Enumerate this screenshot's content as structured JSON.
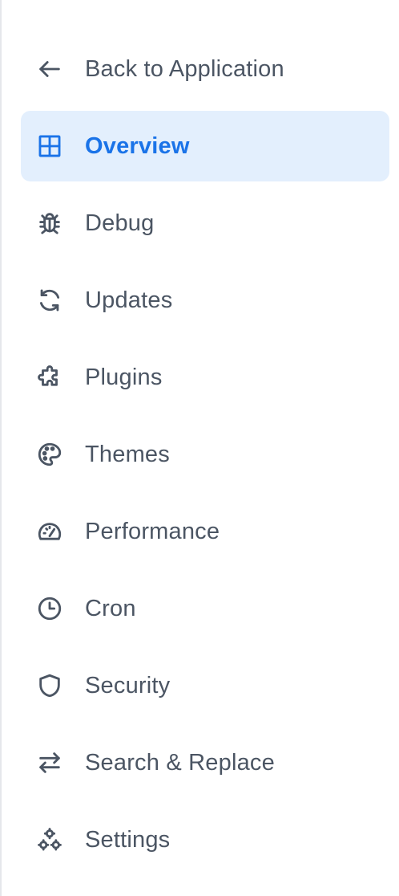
{
  "sidebar": {
    "colors": {
      "text": "#4b5563",
      "active_text": "#1a73e8",
      "active_background": "#e3effd",
      "border": "#e5e7eb"
    },
    "items": [
      {
        "label": "Back to Application",
        "icon": "arrow-left-icon",
        "active": false
      },
      {
        "label": "Overview",
        "icon": "grid-icon",
        "active": true
      },
      {
        "label": "Debug",
        "icon": "bug-icon",
        "active": false
      },
      {
        "label": "Updates",
        "icon": "refresh-icon",
        "active": false
      },
      {
        "label": "Plugins",
        "icon": "puzzle-icon",
        "active": false
      },
      {
        "label": "Themes",
        "icon": "palette-icon",
        "active": false
      },
      {
        "label": "Performance",
        "icon": "gauge-icon",
        "active": false
      },
      {
        "label": "Cron",
        "icon": "clock-icon",
        "active": false
      },
      {
        "label": "Security",
        "icon": "shield-icon",
        "active": false
      },
      {
        "label": "Search & Replace",
        "icon": "arrows-swap-icon",
        "active": false
      },
      {
        "label": "Settings",
        "icon": "cogs-icon",
        "active": false
      }
    ]
  }
}
